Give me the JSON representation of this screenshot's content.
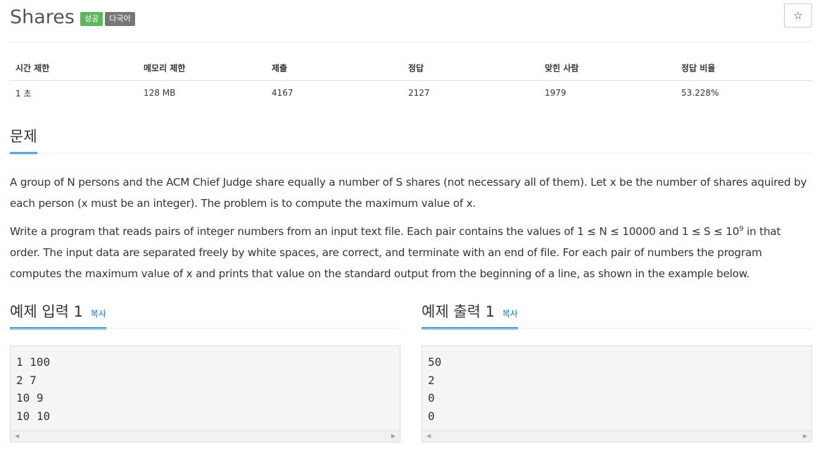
{
  "problem": {
    "title": "Shares",
    "badges": {
      "success": "성공",
      "multi_lang": "다국어"
    },
    "star_icon": "☆"
  },
  "info_table": {
    "headers": [
      "시간 제한",
      "메모리 제한",
      "제출",
      "정답",
      "맞힌 사람",
      "정답 비율"
    ],
    "values": [
      "1 초",
      "128 MB",
      "4167",
      "2127",
      "1979",
      "53.228%"
    ]
  },
  "sections": {
    "problem_label": "문제",
    "sample_input_label": "예제 입력 1",
    "sample_output_label": "예제 출력 1",
    "copy_label": "복사"
  },
  "description": {
    "p1": "A group of N persons and the ACM Chief Judge share equally a number of S shares (not necessary all of them). Let x be the number of shares aquired by each person (x must be an integer). The problem is to compute the maximum value of x.",
    "p2_before": "Write a program that reads pairs of integer numbers from an input text file. Each pair contains the values of 1 ≤ N ≤ 10000 and 1 ≤ S ≤ 10",
    "p2_sup": "9",
    "p2_after": " in that order. The input data are separated freely by white spaces, are correct, and terminate with an end of file. For each pair of numbers the program computes the maximum value of x and prints that value on the standard output from the beginning of a line, as shown in the example below."
  },
  "samples": {
    "input": "1 100\n2 7\n10 9\n10 10",
    "output": "50\n2\n0\n0"
  }
}
